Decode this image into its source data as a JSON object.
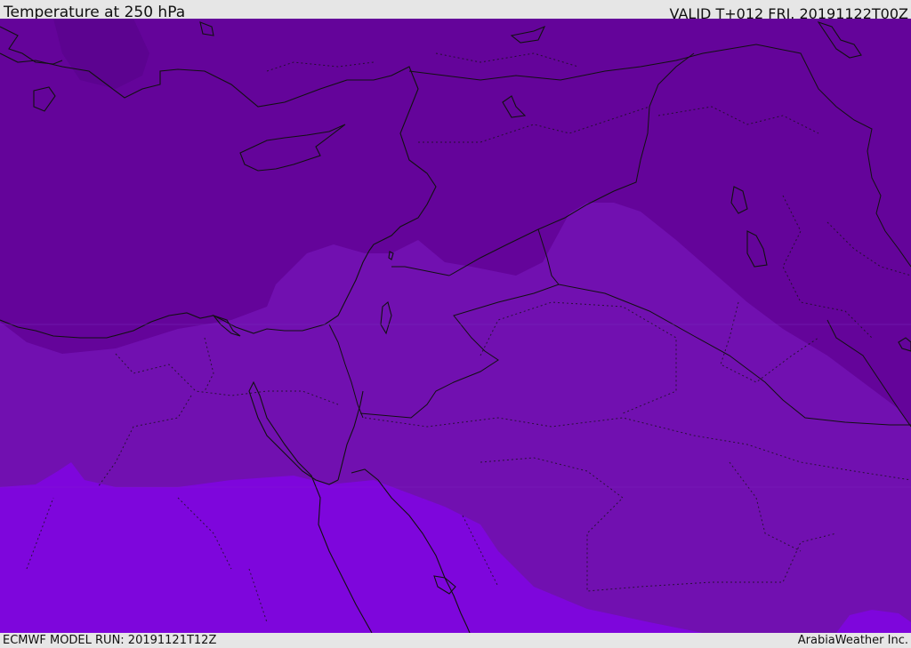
{
  "header": {
    "title": "Temperature at 250 hPa",
    "valid_time": "VALID T+012 FRI. 20191122T00Z"
  },
  "footer": {
    "model_run": "ECMWF MODEL RUN: 20191121T12Z",
    "credit": "ArabiaWeather Inc."
  },
  "colors": {
    "band_coldest": "#5c0390",
    "band_cold": "#64049a",
    "band_mid": "#7110b0",
    "band_warm": "#7e06dc",
    "coastline": "#111111",
    "frame": "#e6e6e6"
  }
}
